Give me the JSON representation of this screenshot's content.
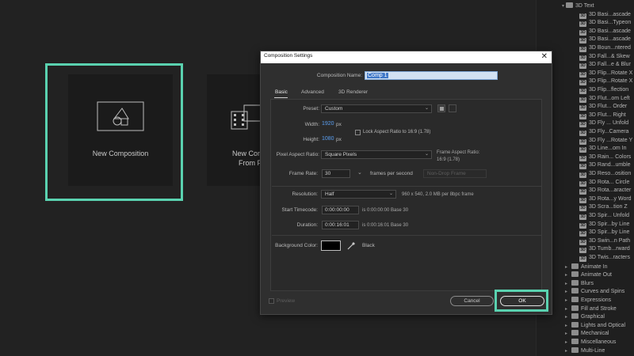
{
  "start_screen": {
    "tiles": [
      {
        "label": "New Composition"
      },
      {
        "label_line1": "New Com",
        "label_line2": "From F"
      }
    ]
  },
  "effects_panel": {
    "group_open": "3D Text",
    "presets": [
      "3D Basi...ascade",
      "3D Basi...Typeon",
      "3D Basi...ascade",
      "3D Basi...ascade",
      "3D Boun...ntered",
      "3D Fall...& Skew",
      "3D Fall...e & Blur",
      "3D Flip...Rotate X",
      "3D Flip...Rotate X",
      "3D Flip...flection",
      "3D Flut...om Left",
      "3D Flut... Order",
      "3D Flut... Right",
      "3D Fly ... Unfold",
      "3D Fly...Camera",
      "3D Fly ...Rotate Y",
      "3D Line...om In",
      "3D Rain... Colors",
      "3D Rand...umble",
      "3D Reso...osition",
      "3D Rota... Circle",
      "3D Rota...aracter",
      "3D Rota...y Word",
      "3D Scra...tion Z",
      "3D Spir... Unfold",
      "3D Spir...by Line",
      "3D Spir...by Line",
      "3D Swin...n Path",
      "3D Tumb...rward",
      "3D Twis...racters"
    ],
    "folders": [
      "Animate In",
      "Animate Out",
      "Blurs",
      "Curves and Spins",
      "Expressions",
      "Fill and Stroke",
      "Graphical",
      "Lights and Optical",
      "Mechanical",
      "Miscellaneous",
      "Multi-Line"
    ]
  },
  "dialog": {
    "title": "Composition Settings",
    "close_glyph": "✕",
    "composition_name_label": "Composition Name:",
    "composition_name_value": "Comp 1",
    "tabs": [
      "Basic",
      "Advanced",
      "3D Renderer"
    ],
    "preset_label": "Preset:",
    "preset_value": "Custom",
    "width_label": "Width:",
    "width_value": "1920",
    "width_unit": "px",
    "height_label": "Height:",
    "height_value": "1080",
    "height_unit": "px",
    "lock_aspect_label": "Lock Aspect Ratio to 16:9 (1.78)",
    "lock_aspect_checked": false,
    "pixel_aspect_label": "Pixel Aspect Ratio:",
    "pixel_aspect_value": "Square Pixels",
    "frame_aspect_label": "Frame Aspect Ratio:",
    "frame_aspect_value": "16:9 (1.78)",
    "frame_rate_label": "Frame Rate:",
    "frame_rate_value": "30",
    "frame_rate_unit": "frames per second",
    "drop_frame_value": "Non-Drop Frame",
    "resolution_label": "Resolution:",
    "resolution_value": "Half",
    "resolution_info": "960 x 540, 2.0 MB per 8bpc frame",
    "start_timecode_label": "Start Timecode:",
    "start_timecode_value": "0:00:00:00",
    "start_timecode_info": "is 0:00:00:00  Base 30",
    "duration_label": "Duration:",
    "duration_value": "0:00:16:01",
    "duration_info": "is 0:00:16:01  Base 30",
    "bg_color_label": "Background Color:",
    "bg_color_hex": "#000000",
    "bg_color_name": "Black",
    "preview_label": "Preview",
    "cancel_label": "Cancel",
    "ok_label": "OK"
  },
  "colors": {
    "highlight": "#5ad2b0",
    "link_blue": "#5a9ef0",
    "dialog_bg": "#2f2f2f"
  }
}
